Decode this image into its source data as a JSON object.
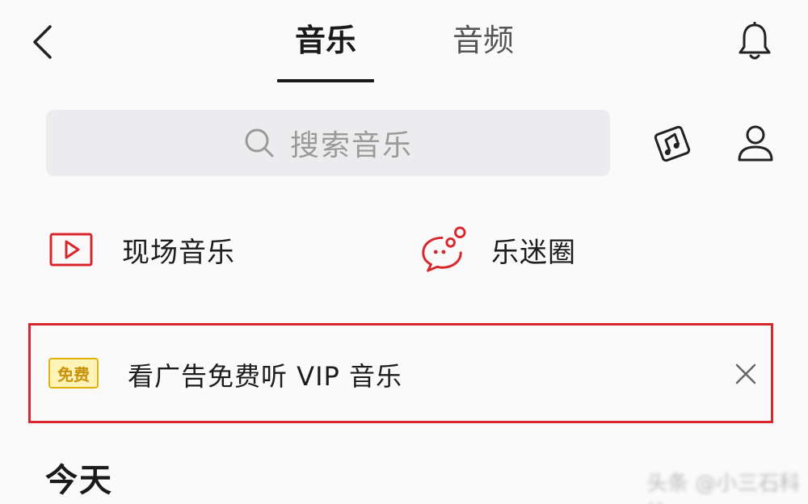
{
  "header": {
    "tabs": [
      {
        "label": "音乐",
        "active": true
      },
      {
        "label": "音频",
        "active": false
      }
    ],
    "back_icon": "chevron-left-icon",
    "notification_icon": "bell-icon"
  },
  "search": {
    "placeholder": "搜索音乐",
    "icon": "search-icon"
  },
  "actions": {
    "recognize_icon": "music-recognize-icon",
    "profile_icon": "user-icon"
  },
  "shortcuts": [
    {
      "label": "现场音乐",
      "icon": "play-box-icon",
      "color": "#d8262c"
    },
    {
      "label": "乐迷圈",
      "icon": "chat-bubble-icon",
      "color": "#d8262c"
    }
  ],
  "ad_banner": {
    "badge": "免费",
    "text": "看广告免费听 VIP 音乐",
    "close_icon": "close-icon",
    "highlight_color": "#d8262c"
  },
  "section": {
    "heading": "今天"
  },
  "watermark": "头条 @小三石科技"
}
